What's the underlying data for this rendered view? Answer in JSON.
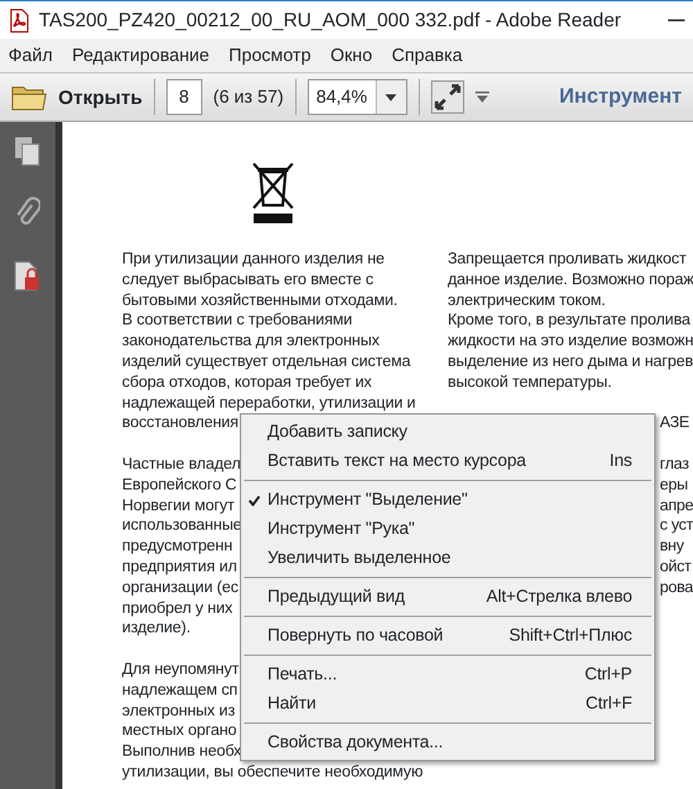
{
  "window": {
    "title": "TAS200_PZ420_00212_00_RU_AOM_000 332.pdf - Adobe Reader"
  },
  "menu_bar": [
    "Файл",
    "Редактирование",
    "Просмотр",
    "Окно",
    "Справка"
  ],
  "toolbar": {
    "open_label": "Открыть",
    "page_number": "8",
    "page_count": "(6 из 57)",
    "zoom": "84,4%",
    "tools_label": "Инструмент"
  },
  "document": {
    "left_column": [
      [
        "При утилизации данного изделия не",
        "следует выбрасывать его вместе с",
        "бытовыми хозяйственными отходами.",
        "В соответствии с требованиями",
        "законодательства для электронных",
        "изделий существует отдельная система",
        "сбора отходов, которая требует их",
        "надлежащей переработки, утилизации и",
        "восстановления"
      ],
      [
        "Частные владел",
        "Европейского С",
        "Норвегии могут",
        "использованные",
        "предусмотренн",
        "предприятия ил",
        "организации (ес",
        "приобрел у них",
        "изделие)."
      ],
      [
        "Для неупомянут",
        "надлежащем сп",
        "электронных из",
        "местных органо",
        "Выполнив необх",
        "утилизации, вы обеспечите необходимую"
      ]
    ],
    "right_column": [
      "Запрещается проливать жидкост",
      "данное изделие. Возможно пораж",
      "электрическим током.",
      "Кроме того, в результате пролива",
      "жидкости на это изделие возможн",
      "выделение из него дыма и нагрев",
      "высокой температуры."
    ],
    "right_fragments": [
      [
        "АЗЕ"
      ],
      [
        "глаз",
        "еры",
        "апре",
        "с уст",
        "вну",
        "ойст",
        "рова"
      ]
    ]
  },
  "context_menu": [
    {
      "kind": "item",
      "label": "Добавить записку",
      "checked": false
    },
    {
      "kind": "item",
      "label": "Вставить текст на место курсора",
      "shortcut": "Ins",
      "checked": false
    },
    {
      "kind": "separator"
    },
    {
      "kind": "item",
      "label": "Инструмент \"Выделение\"",
      "checked": true
    },
    {
      "kind": "item",
      "label": "Инструмент \"Рука\"",
      "checked": false
    },
    {
      "kind": "item",
      "label": "Увеличить выделенное",
      "checked": false
    },
    {
      "kind": "separator"
    },
    {
      "kind": "item",
      "label": "Предыдущий вид",
      "shortcut": "Alt+Стрелка влево",
      "checked": false
    },
    {
      "kind": "separator"
    },
    {
      "kind": "item",
      "label": "Повернуть по часовой",
      "shortcut": "Shift+Ctrl+Плюс",
      "checked": false
    },
    {
      "kind": "separator"
    },
    {
      "kind": "item",
      "label": "Печать...",
      "shortcut": "Ctrl+P",
      "checked": false
    },
    {
      "kind": "item",
      "label": "Найти",
      "shortcut": "Ctrl+F",
      "checked": false
    },
    {
      "kind": "separator"
    },
    {
      "kind": "item",
      "label": "Свойства документа...",
      "checked": false
    }
  ]
}
